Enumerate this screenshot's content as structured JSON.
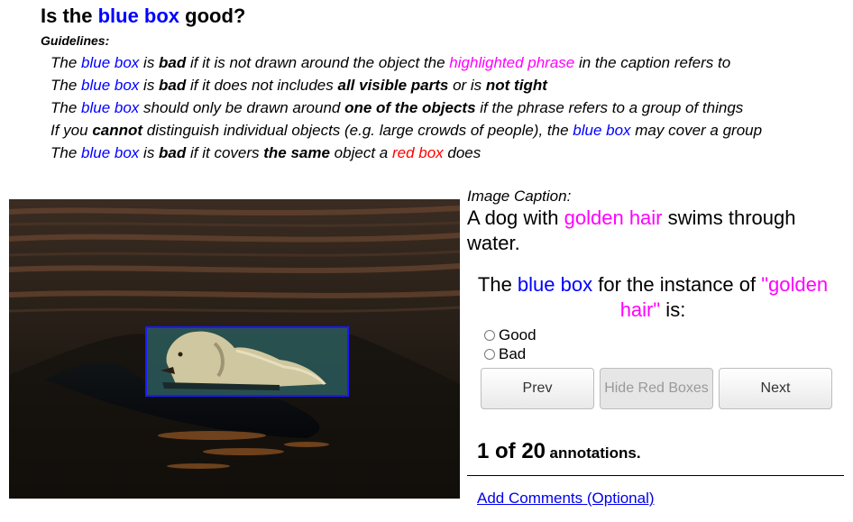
{
  "title": {
    "pre": "Is the ",
    "highlight": "blue box",
    "post": " good?"
  },
  "guidelines_label": "Guidelines:",
  "guidelines": {
    "g1": {
      "a": "The ",
      "blue": "blue box",
      "b": " is ",
      "bad": "bad",
      "c": " if it is not drawn around the object the ",
      "phrase": "highlighted phrase",
      "d": " in the caption refers to"
    },
    "g2": {
      "a": "The ",
      "blue": "blue box",
      "b": " is ",
      "bad": "bad",
      "c": " if it does not includes ",
      "bold1": "all visible parts",
      "d": " or is ",
      "bold2": "not tight"
    },
    "g3": {
      "a": "The ",
      "blue": "blue box",
      "b": " should only be drawn around ",
      "bold1": "one of the objects",
      "c": " if the phrase refers to a group of things"
    },
    "g4": {
      "a": "If you ",
      "bold1": "cannot",
      "b": " distinguish individual objects (e.g. large crowds of people), the ",
      "blue": "blue box",
      "c": " may cover a group"
    },
    "g5": {
      "a": "The ",
      "blue": "blue box",
      "b": " is ",
      "bad": "bad",
      "c": " if it covers ",
      "bold1": "the same",
      "d": " object a ",
      "red": "red box",
      "e": " does"
    }
  },
  "caption_label": "Image Caption",
  "caption": {
    "pre": "A dog with ",
    "phrase": "golden hair",
    "post": " swims through water."
  },
  "question": {
    "a": "The ",
    "blue": "blue box",
    "b": " for the instance of ",
    "phrase": "\"golden hair\"",
    "c": " is:"
  },
  "options": {
    "good": "Good",
    "bad": "Bad"
  },
  "buttons": {
    "prev": "Prev",
    "hide": "Hide Red Boxes",
    "next": "Next"
  },
  "progress": {
    "count": "1 of 20",
    "label": "annotations."
  },
  "add_comments": "Add Comments (Optional)",
  "colors": {
    "blue": "#0000ff",
    "magenta": "#ff00ff",
    "red": "#ff0000",
    "box": "#1a1aff"
  }
}
